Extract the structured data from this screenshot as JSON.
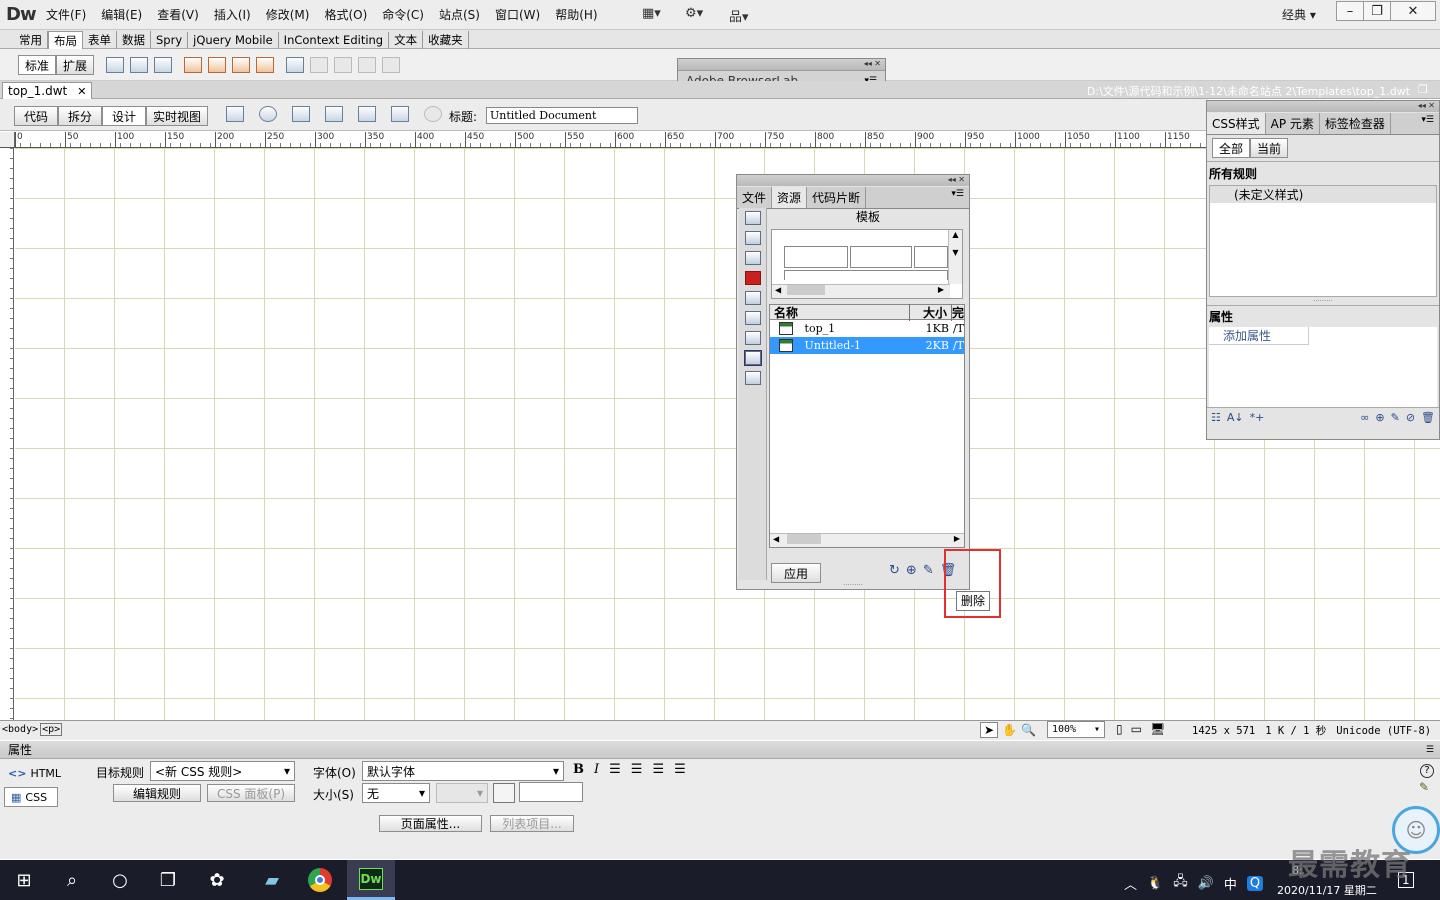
{
  "app": {
    "logo": "Dw",
    "workspace": "经典"
  },
  "menu": [
    "文件(F)",
    "编辑(E)",
    "查看(V)",
    "插入(I)",
    "修改(M)",
    "格式(O)",
    "命令(C)",
    "站点(S)",
    "窗口(W)",
    "帮助(H)"
  ],
  "insert_tabs": [
    "常用",
    "布局",
    "表单",
    "数据",
    "Spry",
    "jQuery Mobile",
    "InContext Editing",
    "文本",
    "收藏夹"
  ],
  "layout_buttons": {
    "standard": "标准",
    "expanded": "扩展"
  },
  "browserlab": {
    "title": "Adobe BrowserLab"
  },
  "document": {
    "tab_name": "top_1.dwt",
    "path": "D:\\文件\\源代码和示例\\1-12\\未命名站点 2\\Templates\\top_1.dwt",
    "view_buttons": [
      "代码",
      "拆分",
      "设计",
      "实时视图"
    ],
    "title_label": "标题:",
    "title_value": "Untitled Document"
  },
  "ruler_labels": [
    "0",
    "50",
    "100",
    "150",
    "200",
    "250",
    "300",
    "350",
    "400",
    "450",
    "500",
    "550",
    "600",
    "650",
    "700",
    "750",
    "800",
    "850",
    "900",
    "950",
    "1000",
    "1050",
    "1100",
    "1150"
  ],
  "status": {
    "tags": [
      "<body>",
      "<p>"
    ],
    "zoom": "100%",
    "dimensions": "1425 x 571",
    "filesize": "1 K / 1 秒",
    "encoding": "Unicode (UTF-8)"
  },
  "properties": {
    "header": "属性",
    "html_btn": "HTML",
    "css_btn": "CSS",
    "target_rule_label": "目标规则",
    "target_rule_value": "<新 CSS 规则>",
    "edit_rule": "编辑规则",
    "css_panel_btn": "CSS 面板(P)",
    "font_label": "字体(O)",
    "font_value": "默认字体",
    "size_label": "大小(S)",
    "size_value": "无",
    "bold": "B",
    "italic": "I",
    "page_props": "页面属性...",
    "list_items": "列表项目..."
  },
  "assets_panel": {
    "tabs": [
      "文件",
      "资源",
      "代码片断"
    ],
    "section": "模板",
    "columns": [
      "名称",
      "大小",
      "完"
    ],
    "rows": [
      {
        "name": "top_1",
        "size": "1KB",
        "path": "/T"
      },
      {
        "name": "Untitled-1",
        "size": "2KB",
        "path": "/T"
      }
    ],
    "apply_btn": "应用",
    "tooltip": "删除"
  },
  "css_panel": {
    "tabs": [
      "CSS样式",
      "AP 元素",
      "标签检查器"
    ],
    "mode_buttons": [
      "全部",
      "当前"
    ],
    "all_rules_header": "所有规则",
    "undefined_style": "(未定义样式)",
    "properties_header": "属性",
    "add_property": "添加属性"
  },
  "taskbar": {
    "time": "8:",
    "date": "2020/11/17 星期二",
    "ime": "中",
    "notif": "1"
  },
  "watermark": "最需教育",
  "colors": {
    "selection": "#3399ff",
    "highlight_box": "#e03030",
    "grid": "#d8d8b4",
    "taskbar": "#1a1c2a"
  }
}
